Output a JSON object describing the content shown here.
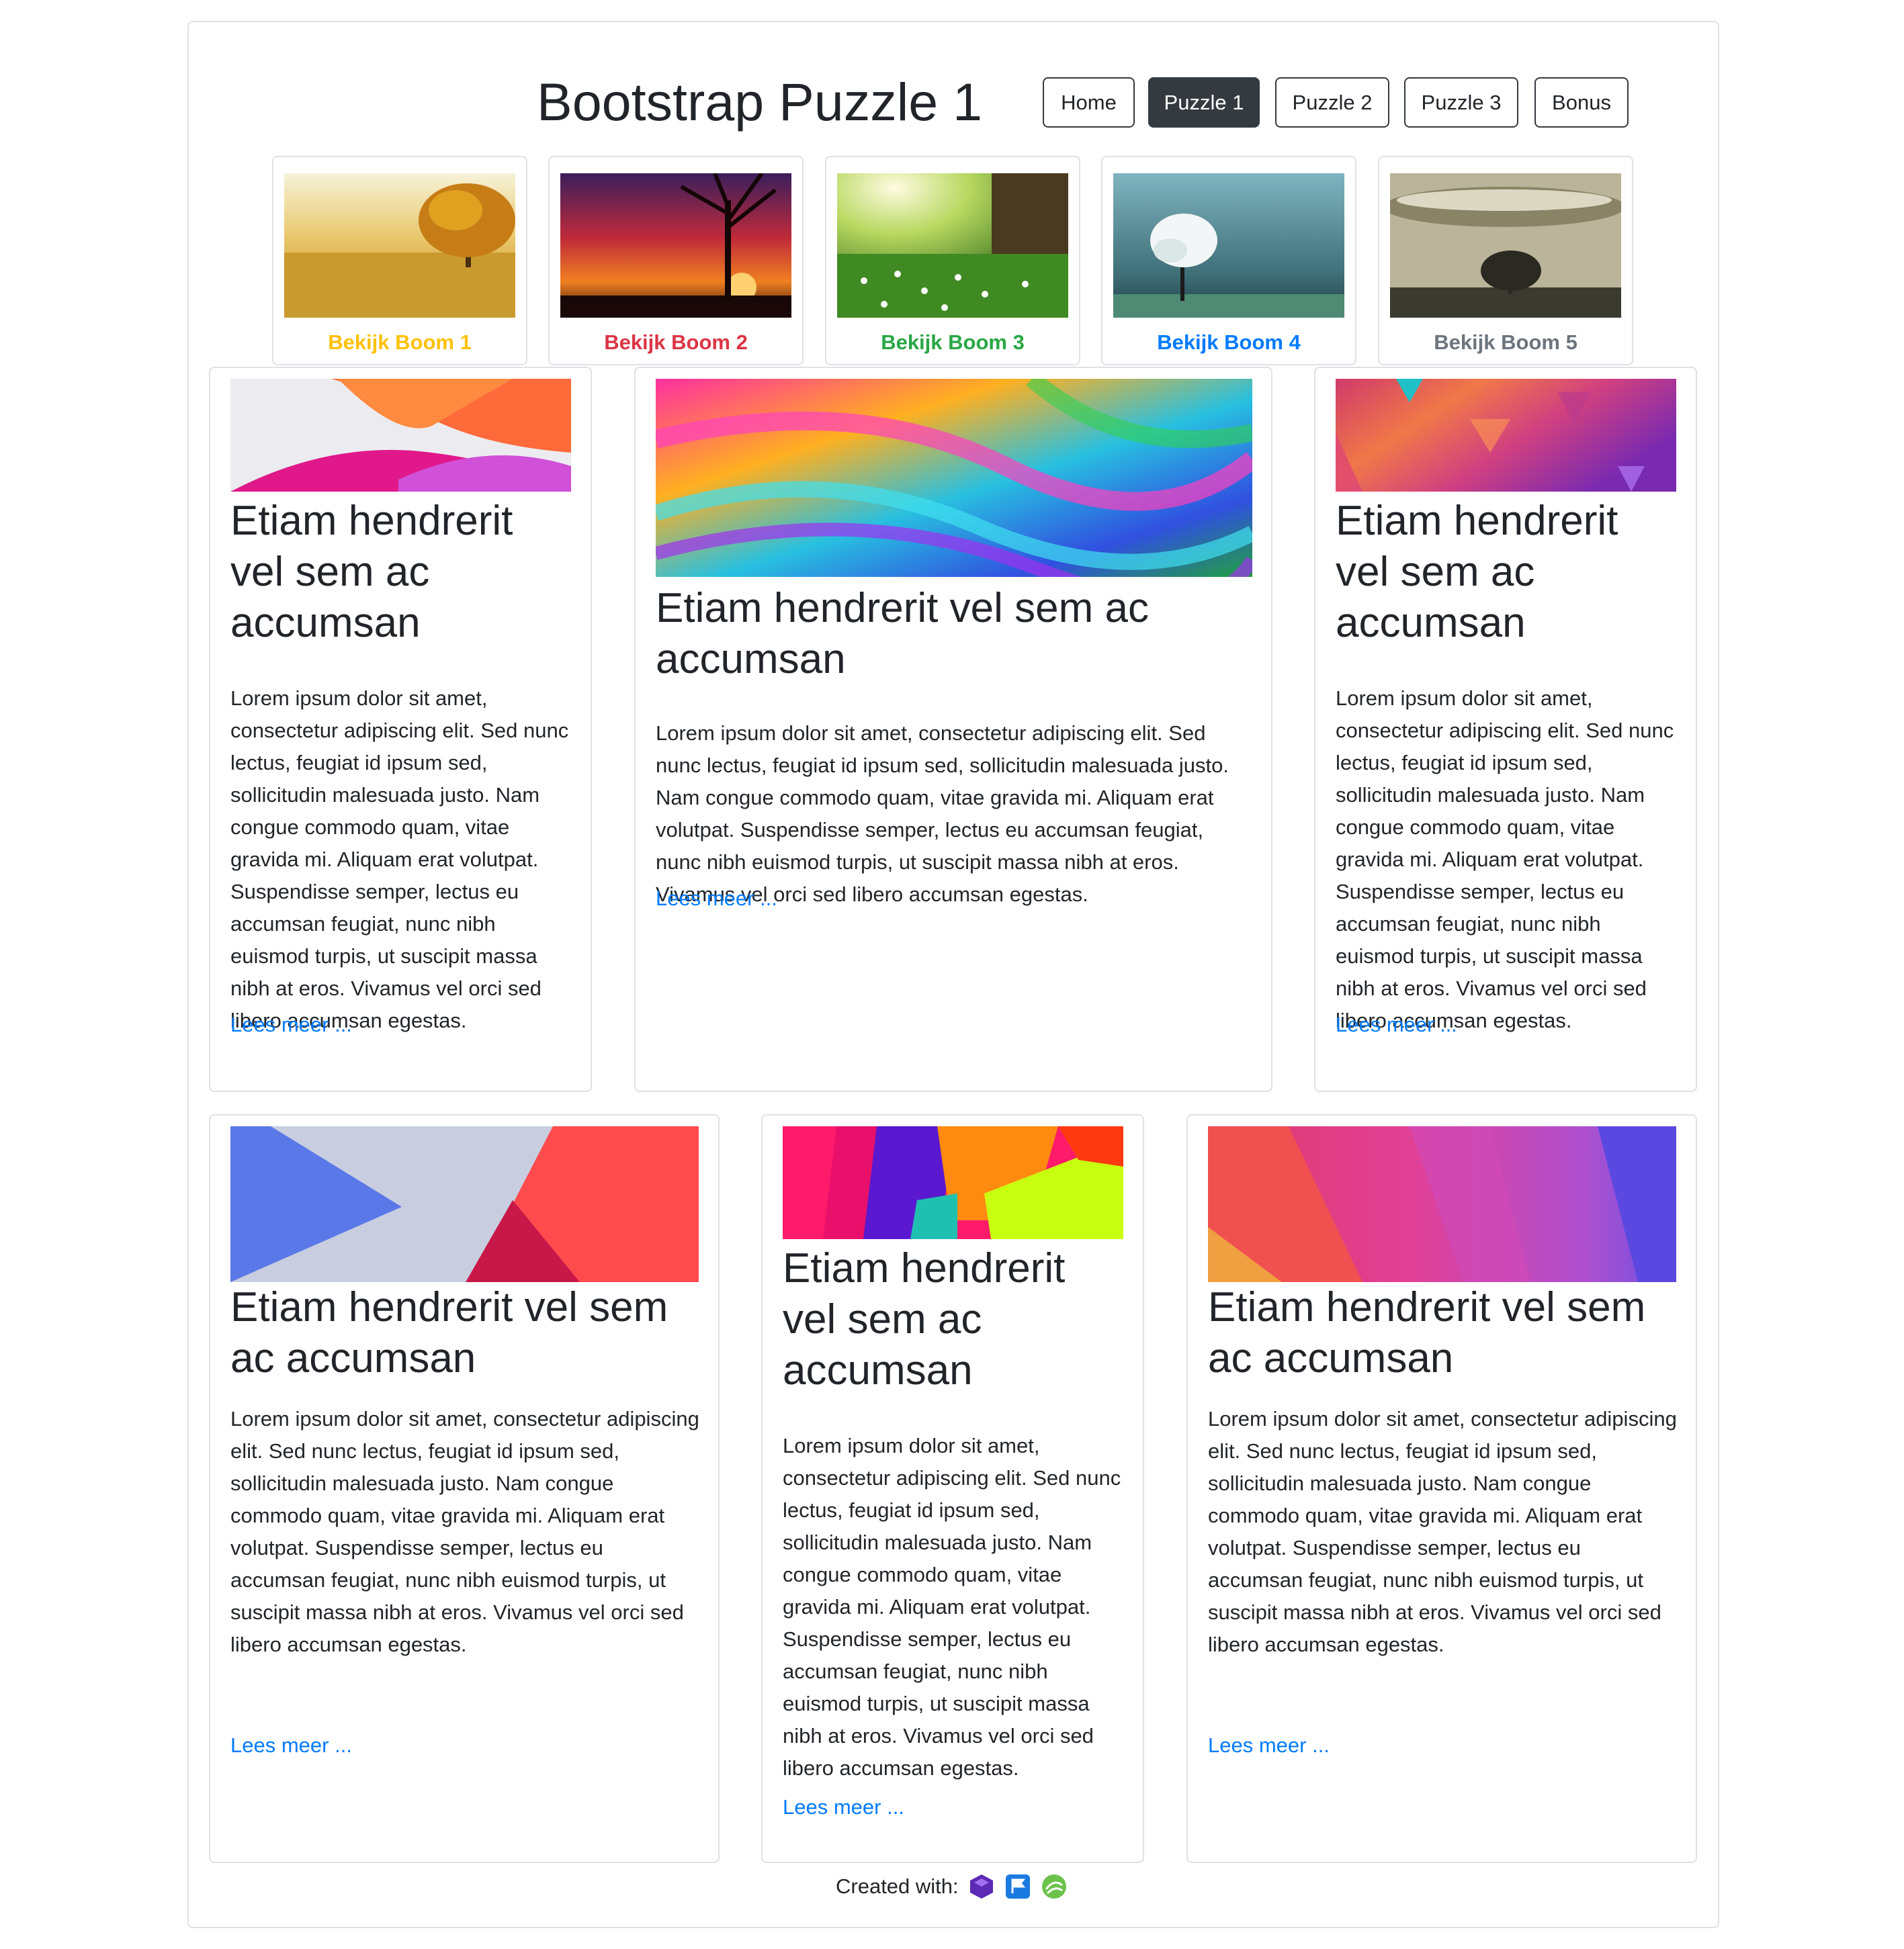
{
  "header": {
    "title": "Bootstrap Puzzle 1"
  },
  "nav": [
    {
      "label": "Home",
      "active": false
    },
    {
      "label": "Puzzle 1",
      "active": true
    },
    {
      "label": "Puzzle 2",
      "active": false
    },
    {
      "label": "Puzzle 3",
      "active": false
    },
    {
      "label": "Bonus",
      "active": false
    }
  ],
  "thumbnails": [
    {
      "caption": "Bekijk Boom 1",
      "color": "#ffc107"
    },
    {
      "caption": "Bekijk Boom 2",
      "color": "#dc3545"
    },
    {
      "caption": "Bekijk Boom 3",
      "color": "#28a745"
    },
    {
      "caption": "Bekijk Boom 4",
      "color": "#007bff"
    },
    {
      "caption": "Bekijk Boom 5",
      "color": "#6c757d"
    }
  ],
  "cards": [
    {
      "heading": "Etiam hendrerit vel sem ac accumsan",
      "text": "Lorem ipsum dolor sit amet, consectetur adipiscing elit. Sed nunc lectus, feugiat id ipsum sed, sollicitudin malesuada justo. Nam congue commodo quam, vitae gravida mi. Aliquam erat volutpat. Suspendisse semper, lectus eu accumsan feugiat, nunc nibh euismod turpis, ut suscipit massa nibh at eros. Vivamus vel orci sed libero accumsan egestas.",
      "link": "Lees meer ..."
    },
    {
      "heading": "Etiam hendrerit vel sem ac accumsan",
      "text": "Lorem ipsum dolor sit amet, consectetur adipiscing elit. Sed nunc lectus, feugiat id ipsum sed, sollicitudin malesuada justo. Nam congue commodo quam, vitae gravida mi. Aliquam erat volutpat. Suspendisse semper, lectus eu accumsan feugiat, nunc nibh euismod turpis, ut suscipit massa nibh at eros. Vivamus vel orci sed libero accumsan egestas.",
      "link": "Lees meer ..."
    },
    {
      "heading": "Etiam hendrerit vel sem ac accumsan",
      "text": "Lorem ipsum dolor sit amet, consectetur adipiscing elit. Sed nunc lectus, feugiat id ipsum sed, sollicitudin malesuada justo. Nam congue commodo quam, vitae gravida mi. Aliquam erat volutpat. Suspendisse semper, lectus eu accumsan feugiat, nunc nibh euismod turpis, ut suscipit massa nibh at eros. Vivamus vel orci sed libero accumsan egestas.",
      "link": "Lees meer ..."
    },
    {
      "heading": "Etiam hendrerit vel sem ac accumsan",
      "text": "Lorem ipsum dolor sit amet, consectetur adipiscing elit. Sed nunc lectus, feugiat id ipsum sed, sollicitudin malesuada justo. Nam congue commodo quam, vitae gravida mi. Aliquam erat volutpat. Suspendisse semper, lectus eu accumsan feugiat, nunc nibh euismod turpis, ut suscipit massa nibh at eros. Vivamus vel orci sed libero accumsan egestas.",
      "link": "Lees meer ..."
    },
    {
      "heading": "Etiam hendrerit vel sem ac accumsan",
      "text": "Lorem ipsum dolor sit amet, consectetur adipiscing elit. Sed nunc lectus, feugiat id ipsum sed, sollicitudin malesuada justo. Nam congue commodo quam, vitae gravida mi. Aliquam erat volutpat. Suspendisse semper, lectus eu accumsan feugiat, nunc nibh euismod turpis, ut suscipit massa nibh at eros. Vivamus vel orci sed libero accumsan egestas.",
      "link": "Lees meer ..."
    },
    {
      "heading": "Etiam hendrerit vel sem ac accumsan",
      "text": "Lorem ipsum dolor sit amet, consectetur adipiscing elit. Sed nunc lectus, feugiat id ipsum sed, sollicitudin malesuada justo. Nam congue commodo quam, vitae gravida mi. Aliquam erat volutpat. Suspendisse semper, lectus eu accumsan feugiat, nunc nibh euismod turpis, ut suscipit massa nibh at eros. Vivamus vel orci sed libero accumsan egestas.",
      "link": "Lees meer ..."
    }
  ],
  "footer": {
    "label": "Created with:",
    "icons": [
      "bootstrap-studio-icon",
      "flag-app-icon",
      "green-logo-icon"
    ]
  }
}
